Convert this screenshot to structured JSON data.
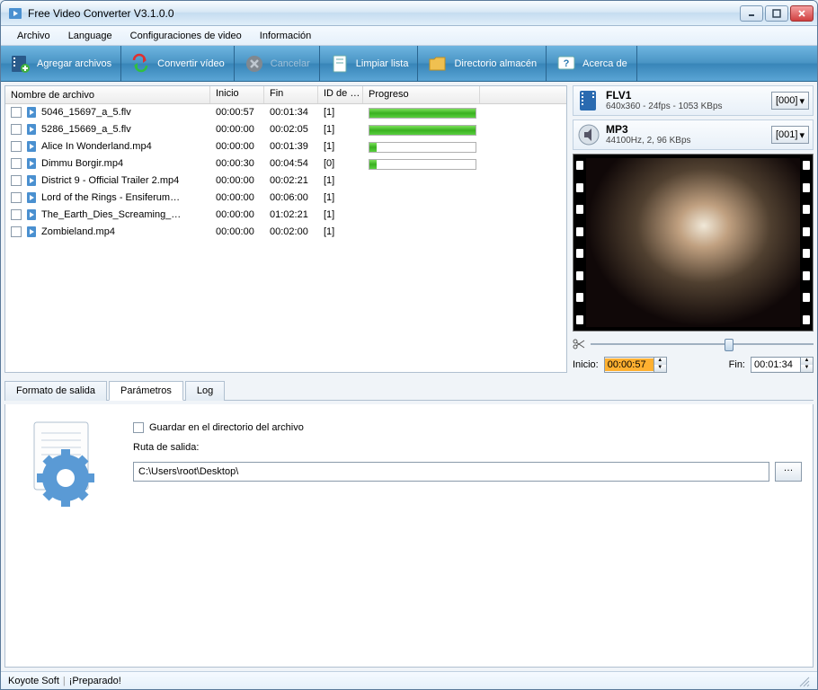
{
  "window": {
    "title": "Free Video Converter V3.1.0.0"
  },
  "menu": {
    "file": "Archivo",
    "language": "Language",
    "videocfg": "Configuraciones de video",
    "info": "Información"
  },
  "toolbar": {
    "add": "Agregar archivos",
    "convert": "Convertir vídeo",
    "cancel": "Cancelar",
    "clear": "Limpiar lista",
    "dir": "Directorio almacén",
    "about": "Acerca de"
  },
  "columns": {
    "name": "Nombre de archivo",
    "start": "Inicio",
    "end": "Fin",
    "id": "ID de …",
    "progress": "Progreso"
  },
  "files": [
    {
      "name": "5046_15697_a_5.flv",
      "start": "00:00:57",
      "end": "00:01:34",
      "id": "[1]",
      "prog": "full"
    },
    {
      "name": "5286_15669_a_5.flv",
      "start": "00:00:00",
      "end": "00:02:05",
      "id": "[1]",
      "prog": "full"
    },
    {
      "name": "Alice In Wonderland.mp4",
      "start": "00:00:00",
      "end": "00:01:39",
      "id": "[1]",
      "prog": "partial"
    },
    {
      "name": "Dimmu Borgir.mp4",
      "start": "00:00:30",
      "end": "00:04:54",
      "id": "[0]",
      "prog": "partial"
    },
    {
      "name": "District 9 - Official Trailer 2.mp4",
      "start": "00:00:00",
      "end": "00:02:21",
      "id": "[1]",
      "prog": "none"
    },
    {
      "name": "Lord of the Rings - Ensiferum…",
      "start": "00:00:00",
      "end": "00:06:00",
      "id": "[1]",
      "prog": "none"
    },
    {
      "name": "The_Earth_Dies_Screaming_…",
      "start": "00:00:00",
      "end": "01:02:21",
      "id": "[1]",
      "prog": "none"
    },
    {
      "name": "Zombieland.mp4",
      "start": "00:00:00",
      "end": "00:02:00",
      "id": "[1]",
      "prog": "none"
    }
  ],
  "format": {
    "video": {
      "codec": "FLV1",
      "detail": "640x360 - 24fps - 1053 KBps",
      "preset": "[000]"
    },
    "audio": {
      "codec": "MP3",
      "detail": "44100Hz, 2, 96 KBps",
      "preset": "[001]"
    }
  },
  "trim": {
    "start_label": "Inicio:",
    "start": "00:00:57",
    "end_label": "Fin:",
    "end": "00:01:34"
  },
  "tabs": {
    "output": "Formato de salida",
    "params": "Parámetros",
    "log": "Log"
  },
  "params": {
    "save_in_dir": "Guardar en el directorio del archivo",
    "path_label": "Ruta de salida:",
    "path": "C:\\Users\\root\\Desktop\\",
    "browse": "…"
  },
  "status": {
    "vendor": "Koyote Soft",
    "ready": "¡Preparado!"
  }
}
